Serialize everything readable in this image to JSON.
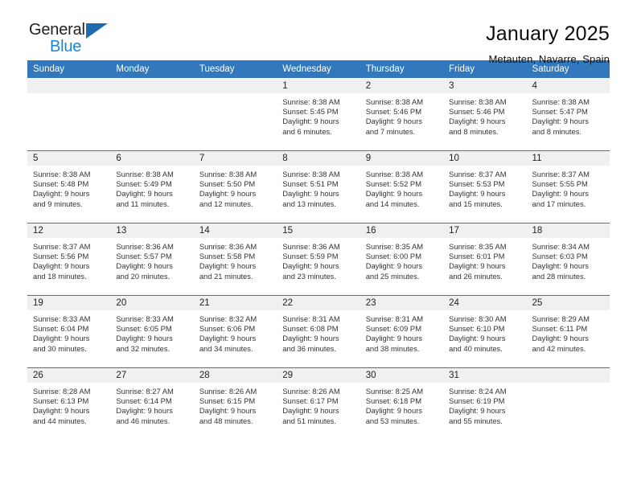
{
  "logo": {
    "word_one": "General",
    "word_two": "Blue",
    "triangle": "triangle-mark",
    "accent_dark": "#231f20",
    "accent_blue": "#1d85d0",
    "triangle_blue": "#1f6bb0"
  },
  "header": {
    "title": "January 2025",
    "subtitle": "Metauten, Navarre, Spain"
  },
  "colors": {
    "header_row": "#3179bc",
    "daynum_strip": "#f0f0f0",
    "text": "#333333"
  },
  "calendar": {
    "weekday_headers": [
      "Sunday",
      "Monday",
      "Tuesday",
      "Wednesday",
      "Thursday",
      "Friday",
      "Saturday"
    ],
    "weeks": [
      [
        {
          "day": "",
          "lines": []
        },
        {
          "day": "",
          "lines": []
        },
        {
          "day": "",
          "lines": []
        },
        {
          "day": "1",
          "lines": [
            "Sunrise: 8:38 AM",
            "Sunset: 5:45 PM",
            "Daylight: 9 hours",
            "and 6 minutes."
          ]
        },
        {
          "day": "2",
          "lines": [
            "Sunrise: 8:38 AM",
            "Sunset: 5:46 PM",
            "Daylight: 9 hours",
            "and 7 minutes."
          ]
        },
        {
          "day": "3",
          "lines": [
            "Sunrise: 8:38 AM",
            "Sunset: 5:46 PM",
            "Daylight: 9 hours",
            "and 8 minutes."
          ]
        },
        {
          "day": "4",
          "lines": [
            "Sunrise: 8:38 AM",
            "Sunset: 5:47 PM",
            "Daylight: 9 hours",
            "and 8 minutes."
          ]
        }
      ],
      [
        {
          "day": "5",
          "lines": [
            "Sunrise: 8:38 AM",
            "Sunset: 5:48 PM",
            "Daylight: 9 hours",
            "and 9 minutes."
          ]
        },
        {
          "day": "6",
          "lines": [
            "Sunrise: 8:38 AM",
            "Sunset: 5:49 PM",
            "Daylight: 9 hours",
            "and 11 minutes."
          ]
        },
        {
          "day": "7",
          "lines": [
            "Sunrise: 8:38 AM",
            "Sunset: 5:50 PM",
            "Daylight: 9 hours",
            "and 12 minutes."
          ]
        },
        {
          "day": "8",
          "lines": [
            "Sunrise: 8:38 AM",
            "Sunset: 5:51 PM",
            "Daylight: 9 hours",
            "and 13 minutes."
          ]
        },
        {
          "day": "9",
          "lines": [
            "Sunrise: 8:38 AM",
            "Sunset: 5:52 PM",
            "Daylight: 9 hours",
            "and 14 minutes."
          ]
        },
        {
          "day": "10",
          "lines": [
            "Sunrise: 8:37 AM",
            "Sunset: 5:53 PM",
            "Daylight: 9 hours",
            "and 15 minutes."
          ]
        },
        {
          "day": "11",
          "lines": [
            "Sunrise: 8:37 AM",
            "Sunset: 5:55 PM",
            "Daylight: 9 hours",
            "and 17 minutes."
          ]
        }
      ],
      [
        {
          "day": "12",
          "lines": [
            "Sunrise: 8:37 AM",
            "Sunset: 5:56 PM",
            "Daylight: 9 hours",
            "and 18 minutes."
          ]
        },
        {
          "day": "13",
          "lines": [
            "Sunrise: 8:36 AM",
            "Sunset: 5:57 PM",
            "Daylight: 9 hours",
            "and 20 minutes."
          ]
        },
        {
          "day": "14",
          "lines": [
            "Sunrise: 8:36 AM",
            "Sunset: 5:58 PM",
            "Daylight: 9 hours",
            "and 21 minutes."
          ]
        },
        {
          "day": "15",
          "lines": [
            "Sunrise: 8:36 AM",
            "Sunset: 5:59 PM",
            "Daylight: 9 hours",
            "and 23 minutes."
          ]
        },
        {
          "day": "16",
          "lines": [
            "Sunrise: 8:35 AM",
            "Sunset: 6:00 PM",
            "Daylight: 9 hours",
            "and 25 minutes."
          ]
        },
        {
          "day": "17",
          "lines": [
            "Sunrise: 8:35 AM",
            "Sunset: 6:01 PM",
            "Daylight: 9 hours",
            "and 26 minutes."
          ]
        },
        {
          "day": "18",
          "lines": [
            "Sunrise: 8:34 AM",
            "Sunset: 6:03 PM",
            "Daylight: 9 hours",
            "and 28 minutes."
          ]
        }
      ],
      [
        {
          "day": "19",
          "lines": [
            "Sunrise: 8:33 AM",
            "Sunset: 6:04 PM",
            "Daylight: 9 hours",
            "and 30 minutes."
          ]
        },
        {
          "day": "20",
          "lines": [
            "Sunrise: 8:33 AM",
            "Sunset: 6:05 PM",
            "Daylight: 9 hours",
            "and 32 minutes."
          ]
        },
        {
          "day": "21",
          "lines": [
            "Sunrise: 8:32 AM",
            "Sunset: 6:06 PM",
            "Daylight: 9 hours",
            "and 34 minutes."
          ]
        },
        {
          "day": "22",
          "lines": [
            "Sunrise: 8:31 AM",
            "Sunset: 6:08 PM",
            "Daylight: 9 hours",
            "and 36 minutes."
          ]
        },
        {
          "day": "23",
          "lines": [
            "Sunrise: 8:31 AM",
            "Sunset: 6:09 PM",
            "Daylight: 9 hours",
            "and 38 minutes."
          ]
        },
        {
          "day": "24",
          "lines": [
            "Sunrise: 8:30 AM",
            "Sunset: 6:10 PM",
            "Daylight: 9 hours",
            "and 40 minutes."
          ]
        },
        {
          "day": "25",
          "lines": [
            "Sunrise: 8:29 AM",
            "Sunset: 6:11 PM",
            "Daylight: 9 hours",
            "and 42 minutes."
          ]
        }
      ],
      [
        {
          "day": "26",
          "lines": [
            "Sunrise: 8:28 AM",
            "Sunset: 6:13 PM",
            "Daylight: 9 hours",
            "and 44 minutes."
          ]
        },
        {
          "day": "27",
          "lines": [
            "Sunrise: 8:27 AM",
            "Sunset: 6:14 PM",
            "Daylight: 9 hours",
            "and 46 minutes."
          ]
        },
        {
          "day": "28",
          "lines": [
            "Sunrise: 8:26 AM",
            "Sunset: 6:15 PM",
            "Daylight: 9 hours",
            "and 48 minutes."
          ]
        },
        {
          "day": "29",
          "lines": [
            "Sunrise: 8:26 AM",
            "Sunset: 6:17 PM",
            "Daylight: 9 hours",
            "and 51 minutes."
          ]
        },
        {
          "day": "30",
          "lines": [
            "Sunrise: 8:25 AM",
            "Sunset: 6:18 PM",
            "Daylight: 9 hours",
            "and 53 minutes."
          ]
        },
        {
          "day": "31",
          "lines": [
            "Sunrise: 8:24 AM",
            "Sunset: 6:19 PM",
            "Daylight: 9 hours",
            "and 55 minutes."
          ]
        },
        {
          "day": "",
          "lines": []
        }
      ]
    ]
  }
}
